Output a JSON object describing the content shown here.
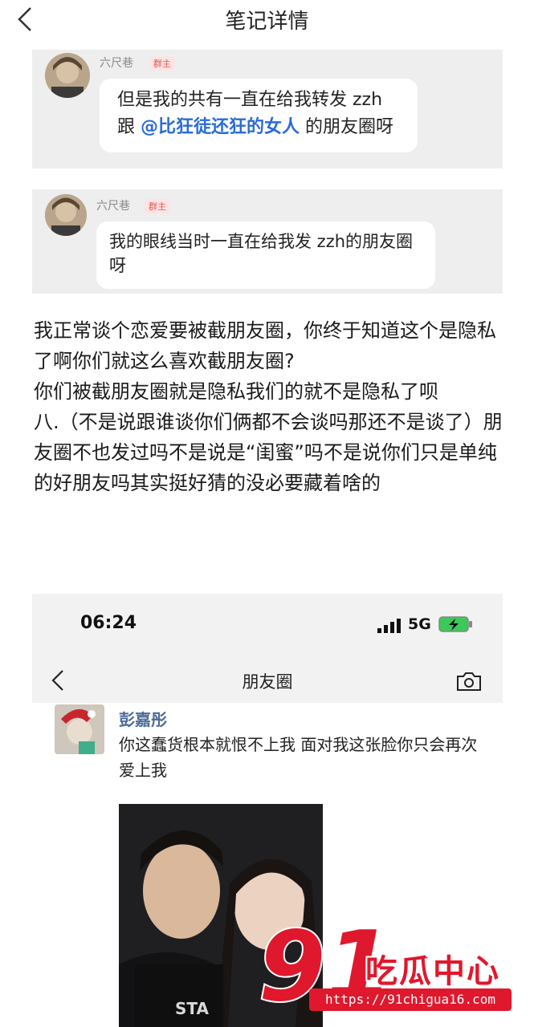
{
  "header": {
    "title": "笔记详情"
  },
  "comments": [
    {
      "username": "六尺巷",
      "tag": "群主",
      "text_before": "但是我的共有一直在给我转发 zzh 跟",
      "mention": "@比狂徒还狂的女人",
      "text_after": " 的朋友圈呀"
    },
    {
      "username": "六尺巷",
      "tag": "群主",
      "text": "我的眼线当时一直在给我发 zzh的朋友圈呀"
    }
  ],
  "body": {
    "paragraphs": [
      "我正常谈个恋爱要被截朋友圈，你终于知道这个是隐私了啊你们就这么喜欢截朋友圈?",
      "你们被截朋友圈就是隐私我们的就不是隐私了呗",
      "八.（不是说跟谁谈你们俩都不会谈吗那还不是谈了）朋友圈不也发过吗不是说是“闺蜜”吗不是说你们只是单纯的好朋友吗其实挺好猜的没必要藏着啥的"
    ]
  },
  "screenshot": {
    "time": "06:24",
    "network": "5G",
    "page_title": "朋友圈",
    "poster_name": "彭嘉彤",
    "post_text": "你这蠢货根本就恨不上我 面对我这张脸你只会再次爱上我",
    "icons": [
      "back-icon",
      "camera-icon",
      "signal-icon",
      "battery-charging-icon"
    ]
  },
  "watermark": {
    "number": "91",
    "name": "吃瓜中心",
    "url": "https://91chigua16.com"
  },
  "colors": {
    "mention": "#2a6bd6",
    "watermark": "#e0182d",
    "tag": "#e05a5a"
  }
}
